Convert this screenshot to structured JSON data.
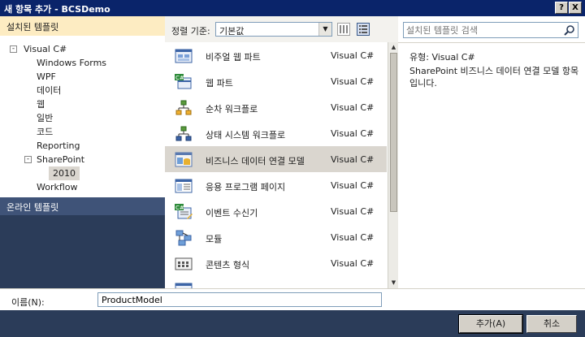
{
  "window": {
    "title": "새 항목 추가 - BCSDemo",
    "help": "?",
    "close": "X"
  },
  "left": {
    "header": "설치된 템플릿",
    "tree": [
      {
        "label": "Visual C#",
        "toggle": "-"
      },
      {
        "label": "Windows Forms"
      },
      {
        "label": "WPF"
      },
      {
        "label": "데이터"
      },
      {
        "label": "웹"
      },
      {
        "label": "일반"
      },
      {
        "label": "코드"
      },
      {
        "label": "Reporting"
      },
      {
        "label": "SharePoint",
        "toggle": "-"
      },
      {
        "label": "2010"
      },
      {
        "label": "Workflow"
      }
    ],
    "online": "온라인 템플릿"
  },
  "toolbar": {
    "sort_label": "정렬 기준:",
    "sort_value": "기본값"
  },
  "templates": [
    {
      "name": "비주얼 웹 파트",
      "lang": "Visual C#",
      "icon": "visual-web-part-icon"
    },
    {
      "name": "웹 파트",
      "lang": "Visual C#",
      "icon": "web-part-icon"
    },
    {
      "name": "순차 워크플로",
      "lang": "Visual C#",
      "icon": "sequential-workflow-icon"
    },
    {
      "name": "상태 시스템 워크플로",
      "lang": "Visual C#",
      "icon": "state-machine-workflow-icon"
    },
    {
      "name": "비즈니스 데이터 연결 모델",
      "lang": "Visual C#",
      "icon": "bdc-model-icon",
      "selected": true
    },
    {
      "name": "응용 프로그램 페이지",
      "lang": "Visual C#",
      "icon": "application-page-icon"
    },
    {
      "name": "이벤트 수신기",
      "lang": "Visual C#",
      "icon": "event-receiver-icon"
    },
    {
      "name": "모듈",
      "lang": "Visual C#",
      "icon": "module-icon"
    },
    {
      "name": "콘텐츠 형식",
      "lang": "Visual C#",
      "icon": "content-type-icon"
    }
  ],
  "search": {
    "placeholder": "설치된 템플릿 검색"
  },
  "details": {
    "type_label": "유형:",
    "type_value": "Visual C#",
    "description": "SharePoint 비즈니스 데이터 연결 모델 항목입니다."
  },
  "form": {
    "name_label": "이름(N):",
    "name_value": "ProductModel"
  },
  "buttons": {
    "add": "추가(A)",
    "cancel": "취소"
  }
}
